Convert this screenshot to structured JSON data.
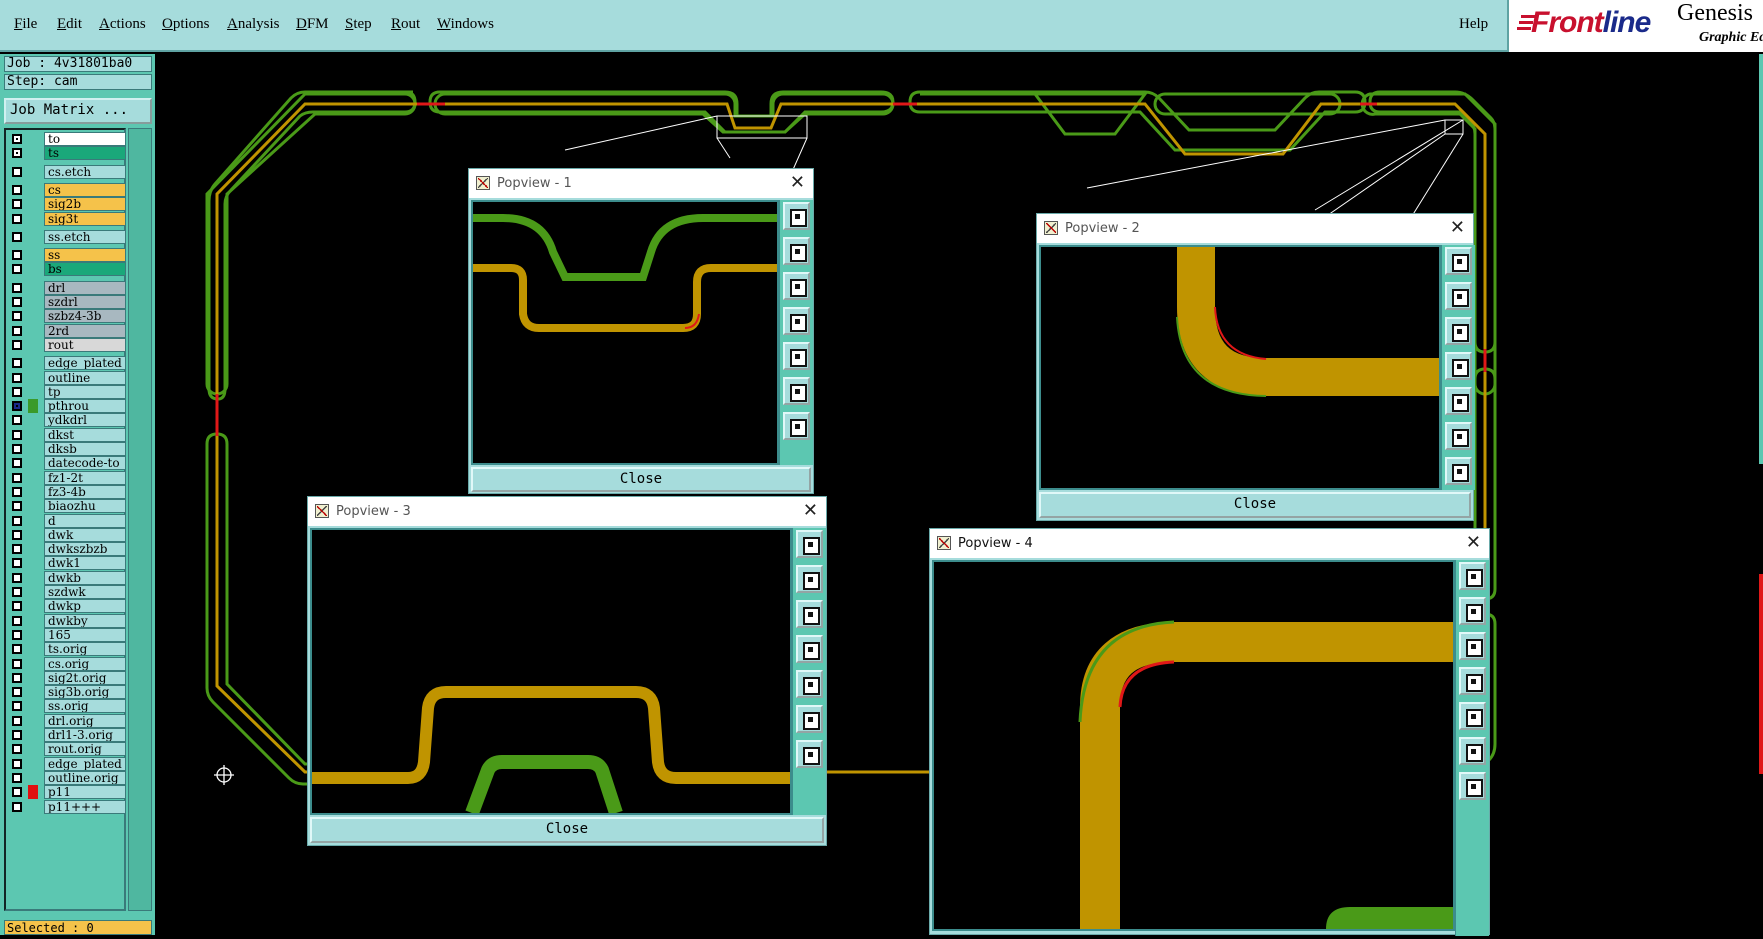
{
  "menubar": {
    "items": [
      {
        "label": "File",
        "u": "F",
        "rest": "ile"
      },
      {
        "label": "Edit",
        "u": "E",
        "rest": "dit"
      },
      {
        "label": "Actions",
        "u": "A",
        "rest": "ctions"
      },
      {
        "label": "Options",
        "u": "O",
        "rest": "ptions"
      },
      {
        "label": "Analysis",
        "u": "A",
        "rest": "nalysis"
      },
      {
        "label": "DFM",
        "u": "D",
        "rest": "FM"
      },
      {
        "label": "Step",
        "u": "S",
        "rest": "tep"
      },
      {
        "label": "Rout",
        "u": "R",
        "rest": "out"
      },
      {
        "label": "Windows",
        "u": "W",
        "rest": "indows"
      }
    ],
    "help": "Help"
  },
  "brand": {
    "logo_front": "Front",
    "logo_line": "line",
    "genesis": "Genesis",
    "subtitle": "Graphic Ed"
  },
  "left": {
    "job": "Job : 4v31801ba0",
    "step": "Step: cam",
    "job_matrix": "Job Matrix ...",
    "selected": "Selected : 0",
    "layers": [
      {
        "name": "to",
        "bg": "#ffffff",
        "sw": "",
        "chk": true
      },
      {
        "name": "ts",
        "bg": "#1aa87a",
        "sw": "",
        "chk": true
      },
      {
        "name": "cs.etch",
        "bg": "#a6dcdc",
        "sw": "",
        "chk": false,
        "gap": true
      },
      {
        "name": "cs",
        "bg": "#f5c24a",
        "sw": "",
        "chk": false,
        "gap": true
      },
      {
        "name": "sig2b",
        "bg": "#f5c24a",
        "sw": "",
        "chk": false
      },
      {
        "name": "sig3t",
        "bg": "#f5c24a",
        "sw": "",
        "chk": false
      },
      {
        "name": "ss.etch",
        "bg": "#a6dcdc",
        "sw": "",
        "chk": false,
        "gap": true
      },
      {
        "name": "ss",
        "bg": "#f5c24a",
        "sw": "",
        "chk": false,
        "gap": true
      },
      {
        "name": "bs",
        "bg": "#1aa87a",
        "sw": "",
        "chk": false
      },
      {
        "name": "drl",
        "bg": "#a8b8c0",
        "sw": "",
        "chk": false,
        "gap": true
      },
      {
        "name": "szdrl",
        "bg": "#a8b8c0",
        "sw": "",
        "chk": false
      },
      {
        "name": "szbz4-3b",
        "bg": "#a8b8c0",
        "sw": "",
        "chk": false
      },
      {
        "name": "2rd",
        "bg": "#a8b8c0",
        "sw": "",
        "chk": false
      },
      {
        "name": "rout",
        "bg": "#d8d8d8",
        "sw": "",
        "chk": false
      },
      {
        "name": "edge_plated",
        "bg": "#a6dcdc",
        "sw": "",
        "chk": false,
        "gap": true
      },
      {
        "name": "outline",
        "bg": "#a6dcdc",
        "sw": "",
        "chk": false
      },
      {
        "name": "tp",
        "bg": "#a6dcdc",
        "sw": "",
        "chk": false
      },
      {
        "name": "pthrou",
        "bg": "#a6dcdc",
        "sw": "#3a9a2a",
        "chk": true,
        "active": true
      },
      {
        "name": "ydkdrl",
        "bg": "#a6dcdc",
        "sw": "",
        "chk": false
      },
      {
        "name": "dkst",
        "bg": "#a6dcdc",
        "sw": "",
        "chk": false
      },
      {
        "name": "dksb",
        "bg": "#a6dcdc",
        "sw": "",
        "chk": false
      },
      {
        "name": "datecode-to",
        "bg": "#a6dcdc",
        "sw": "",
        "chk": false
      },
      {
        "name": "fz1-2t",
        "bg": "#a6dcdc",
        "sw": "",
        "chk": false
      },
      {
        "name": "fz3-4b",
        "bg": "#a6dcdc",
        "sw": "",
        "chk": false
      },
      {
        "name": "biaozhu",
        "bg": "#a6dcdc",
        "sw": "",
        "chk": false
      },
      {
        "name": "d",
        "bg": "#a6dcdc",
        "sw": "",
        "chk": false
      },
      {
        "name": "dwk",
        "bg": "#a6dcdc",
        "sw": "",
        "chk": false
      },
      {
        "name": "dwkszbzb",
        "bg": "#a6dcdc",
        "sw": "",
        "chk": false
      },
      {
        "name": "dwk1",
        "bg": "#a6dcdc",
        "sw": "",
        "chk": false
      },
      {
        "name": "dwkb",
        "bg": "#a6dcdc",
        "sw": "",
        "chk": false
      },
      {
        "name": "szdwk",
        "bg": "#a6dcdc",
        "sw": "",
        "chk": false
      },
      {
        "name": "dwkp",
        "bg": "#a6dcdc",
        "sw": "",
        "chk": false
      },
      {
        "name": "dwkby",
        "bg": "#a6dcdc",
        "sw": "",
        "chk": false
      },
      {
        "name": "165",
        "bg": "#a6dcdc",
        "sw": "",
        "chk": false
      },
      {
        "name": "ts.orig",
        "bg": "#a6dcdc",
        "sw": "",
        "chk": false
      },
      {
        "name": "cs.orig",
        "bg": "#a6dcdc",
        "sw": "",
        "chk": false
      },
      {
        "name": "sig2t.orig",
        "bg": "#a6dcdc",
        "sw": "",
        "chk": false
      },
      {
        "name": "sig3b.orig",
        "bg": "#a6dcdc",
        "sw": "",
        "chk": false
      },
      {
        "name": "ss.orig",
        "bg": "#a6dcdc",
        "sw": "",
        "chk": false
      },
      {
        "name": "drl.orig",
        "bg": "#a6dcdc",
        "sw": "",
        "chk": false
      },
      {
        "name": "drl1-3.orig",
        "bg": "#a6dcdc",
        "sw": "",
        "chk": false
      },
      {
        "name": "rout.orig",
        "bg": "#a6dcdc",
        "sw": "",
        "chk": false
      },
      {
        "name": "edge_plated",
        "bg": "#a6dcdc",
        "sw": "",
        "chk": false
      },
      {
        "name": "outline.orig",
        "bg": "#a6dcdc",
        "sw": "",
        "chk": false
      },
      {
        "name": "p11",
        "bg": "#a6dcdc",
        "sw": "#e01010",
        "chk": false
      },
      {
        "name": "p11+++",
        "bg": "#a6dcdc",
        "sw": "",
        "chk": false
      }
    ]
  },
  "colors": {
    "green": "#4a9a18",
    "gold": "#c09400",
    "red": "#e01818",
    "panel": "#a6dcdc",
    "teal": "#5cc7b1"
  },
  "popups": [
    {
      "title": "Popview - 1",
      "close": "Close"
    },
    {
      "title": "Popview - 2",
      "close": "Close"
    },
    {
      "title": "Popview - 3",
      "close": "Close"
    },
    {
      "title": "Popview - 4",
      "close": "Close"
    }
  ],
  "icons": {
    "crosshair": "crosshair-icon",
    "close": "close-icon",
    "window": "window-icon"
  }
}
